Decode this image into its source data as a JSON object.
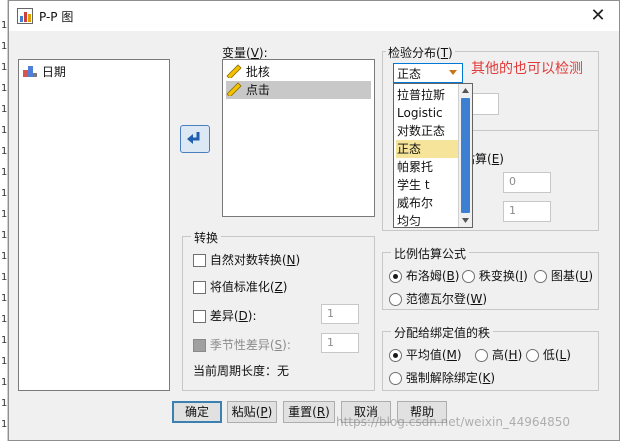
{
  "window": {
    "title": "P-P 图",
    "close_glyph": "✕"
  },
  "source_list": {
    "items": [
      {
        "label": "日期",
        "icon": "date-variable-icon"
      }
    ]
  },
  "variables": {
    "label": "变量",
    "hotkey": "V",
    "suffix": "):",
    "items": [
      {
        "label": "批核",
        "icon": "ruler-pencil-icon"
      },
      {
        "label": "点击",
        "icon": "ruler-pencil-icon"
      }
    ],
    "move_arrow_icon": "arrow-left-icon"
  },
  "test_distribution": {
    "label": "检验分布",
    "hotkey": "T",
    "suffix": ")",
    "selected": "正态",
    "options": [
      "拉普拉斯",
      "Logistic",
      "对数正态",
      "正态",
      "帕累托",
      "学生 t",
      "威布尔",
      "均匀"
    ],
    "hint": "其他的也可以检测",
    "estimate_label_fragment": "估算",
    "estimate_hotkey": "E",
    "param_values": [
      "0",
      "1"
    ]
  },
  "transform": {
    "legend": "转换",
    "natural_log": {
      "text": "自然对数转换",
      "hotkey": "N"
    },
    "standardize": {
      "text": "将值标准化",
      "hotkey": "Z"
    },
    "difference": {
      "text": "差异",
      "hotkey": "D",
      "suffix": "):",
      "value": "1"
    },
    "seasonal": {
      "text": "季节性差异",
      "hotkey": "S",
      "suffix": "):",
      "value": "1"
    },
    "period_label": "当前周期长度：无"
  },
  "proportion": {
    "legend": "比例估算公式",
    "options": [
      {
        "text": "布洛姆",
        "hotkey": "B",
        "checked": true
      },
      {
        "text": "秩变换",
        "hotkey": "I",
        "checked": false
      },
      {
        "text": "图基",
        "hotkey": "U",
        "checked": false
      },
      {
        "text": "范德瓦尔登",
        "hotkey": "W",
        "checked": false
      }
    ]
  },
  "ties": {
    "legend": "分配给绑定值的秩",
    "options": [
      {
        "text": "平均值",
        "hotkey": "M",
        "checked": true
      },
      {
        "text": "高",
        "hotkey": "H",
        "checked": false
      },
      {
        "text": "低",
        "hotkey": "L",
        "checked": false
      },
      {
        "text": "强制解除绑定",
        "hotkey": "K",
        "checked": false
      }
    ]
  },
  "buttons": {
    "ok": "确定",
    "paste": {
      "text": "粘贴",
      "hotkey": "P"
    },
    "reset": {
      "text": "重置",
      "hotkey": "R"
    },
    "cancel": "取消",
    "help": "帮助"
  },
  "watermark": "https://blog.csdn.net/weixin_44964850",
  "background_strip": [
    "1",
    "1",
    "1",
    "1",
    "1",
    "1",
    "1",
    "1",
    "1",
    "1",
    "1",
    "1",
    "1",
    "1",
    "1",
    "1",
    "1",
    "1",
    "1",
    "1"
  ],
  "colors": {
    "hint": "#e03b3b",
    "dropdown_highlight": "#f5e49a",
    "default_button_border": "#3c7fb1",
    "selection": "#c8c8c8"
  }
}
